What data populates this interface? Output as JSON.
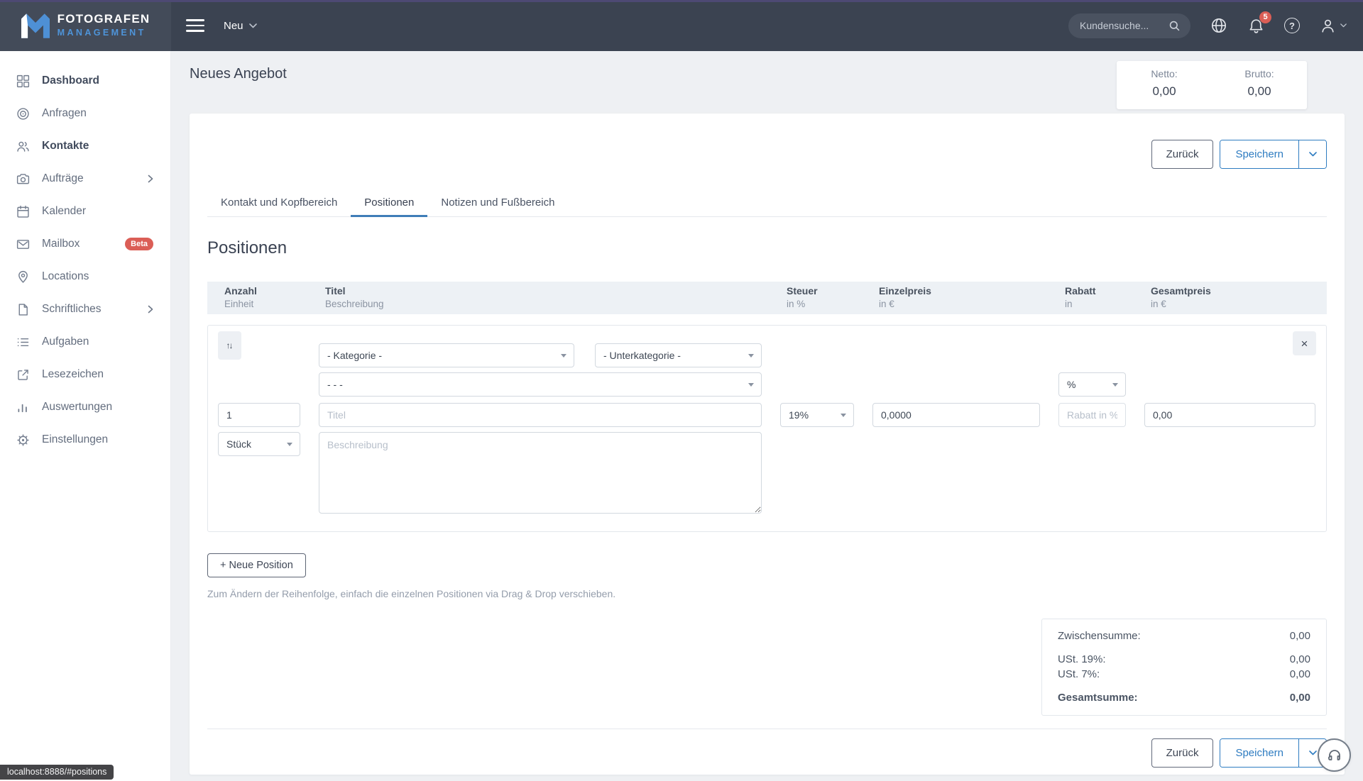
{
  "colors": {
    "topbar_bg": "#3b4351",
    "brand_blue": "#4e94d9",
    "accent_blue": "#2e7cc1",
    "tab_underline_blue": "#3f7db8",
    "badge_red": "#db5e56"
  },
  "topbar": {
    "brand_line1": "FOTOGRAFEN",
    "brand_line2": "MANAGEMENT",
    "neu_label": "Neu",
    "search_placeholder": "Kundensuche...",
    "notification_count": "5",
    "help_glyph": "?"
  },
  "sidebar": {
    "items": [
      {
        "label": "Dashboard"
      },
      {
        "label": "Anfragen"
      },
      {
        "label": "Kontakte"
      },
      {
        "label": "Aufträge"
      },
      {
        "label": "Kalender"
      },
      {
        "label": "Mailbox",
        "badge": "Beta"
      },
      {
        "label": "Locations"
      },
      {
        "label": "Schriftliches"
      },
      {
        "label": "Aufgaben"
      },
      {
        "label": "Lesezeichen"
      },
      {
        "label": "Auswertungen"
      },
      {
        "label": "Einstellungen"
      }
    ]
  },
  "page_header": {
    "title": "Neues Angebot",
    "netto_label": "Netto:",
    "netto_value": "0,00",
    "brutto_label": "Brutto:",
    "brutto_value": "0,00"
  },
  "toolbar": {
    "back_label": "Zurück",
    "save_label": "Speichern"
  },
  "tabs": {
    "items": [
      {
        "label": "Kontakt und Kopfbereich"
      },
      {
        "label": "Positionen"
      },
      {
        "label": "Notizen und Fußbereich"
      }
    ],
    "active": "Positionen"
  },
  "positions": {
    "heading": "Positionen",
    "table_header": [
      {
        "line1": "Anzahl",
        "line2": "Einheit"
      },
      {
        "line1": "Titel",
        "line2": "Beschreibung"
      },
      {
        "line1": "Steuer",
        "line2": "in %"
      },
      {
        "line1": "Einzelpreis",
        "line2": "in €"
      },
      {
        "line1": "Rabatt",
        "line2": "in"
      },
      {
        "line1": "Gesamtpreis",
        "line2": "in €"
      }
    ],
    "row": {
      "sort_icon": "↑↓",
      "close_icon": "×",
      "category_select": "- Kategorie -",
      "subcategory_select": "- Unterkategorie -",
      "preset_select": "- - -",
      "quantity_value": "1",
      "unit_select": "Stück",
      "title_placeholder": "Titel",
      "description_placeholder": "Beschreibung",
      "tax_select": "19%",
      "unit_price_value": "0,0000",
      "discount_unit_select": "%",
      "discount_placeholder": "Rabatt in %",
      "total_value": "0,00"
    },
    "add_button_label": "+ Neue Position",
    "hint": "Zum Ändern der Reihenfolge, einfach die einzelnen Positionen via Drag & Drop verschieben.",
    "summary": {
      "rows": [
        {
          "label": "Zwischensumme:",
          "value": "0,00"
        },
        {
          "label": "USt. 19%:",
          "value": "0,00"
        },
        {
          "label": "USt. 7%:",
          "value": "0,00"
        }
      ],
      "total_label": "Gesamtsumme:",
      "total_value": "0,00"
    }
  },
  "statusbar": {
    "url": "localhost:8888/#positions"
  }
}
